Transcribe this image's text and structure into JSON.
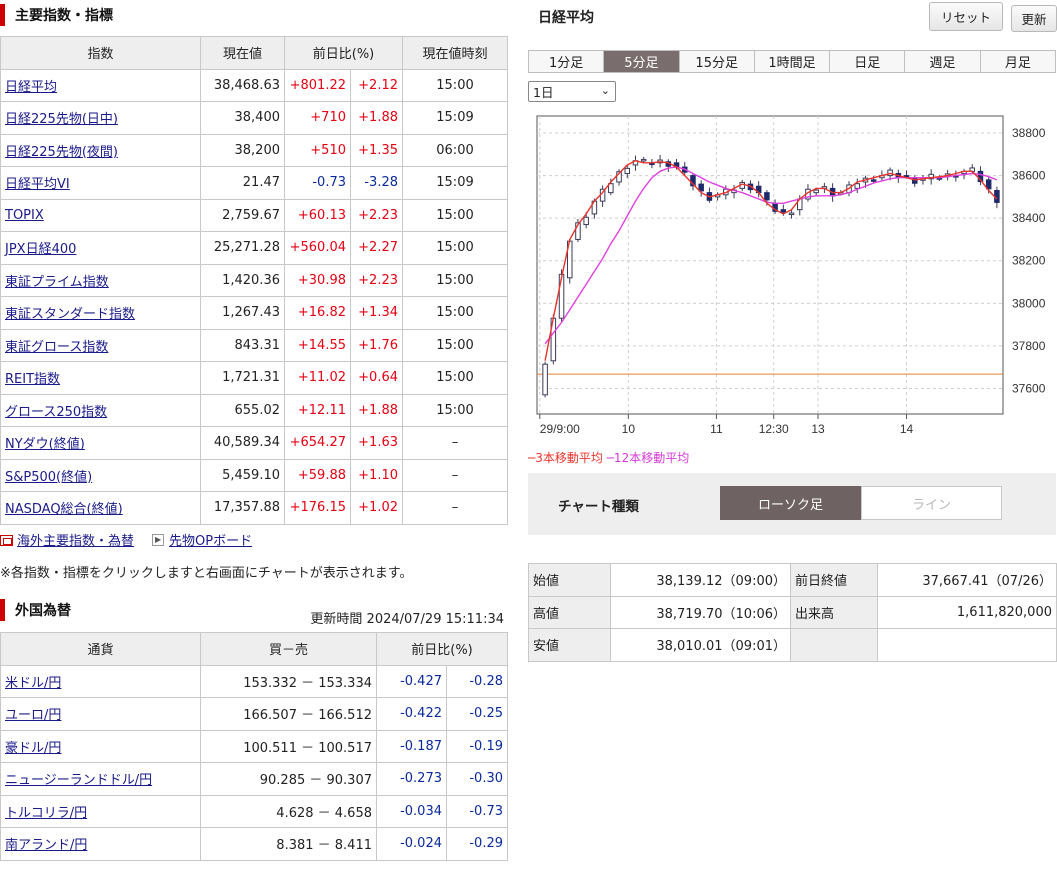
{
  "indices": {
    "section_title": "主要指数・指標",
    "headers": [
      "指数",
      "現在値",
      "前日比(%)",
      "現在値時刻"
    ],
    "rows": [
      {
        "name": "日経平均",
        "price": "38,468.63",
        "chg": "+801.22",
        "pct": "+2.12",
        "time": "15:00",
        "dir": "up"
      },
      {
        "name": "日経225先物(日中)",
        "price": "38,400",
        "chg": "+710",
        "pct": "+1.88",
        "time": "15:09",
        "dir": "up"
      },
      {
        "name": "日経225先物(夜間)",
        "price": "38,200",
        "chg": "+510",
        "pct": "+1.35",
        "time": "06:00",
        "dir": "up"
      },
      {
        "name": "日経平均VI",
        "price": "21.47",
        "chg": "-0.73",
        "pct": "-3.28",
        "time": "15:09",
        "dir": "dn"
      },
      {
        "name": "TOPIX",
        "price": "2,759.67",
        "chg": "+60.13",
        "pct": "+2.23",
        "time": "15:00",
        "dir": "up"
      },
      {
        "name": "JPX日経400",
        "price": "25,271.28",
        "chg": "+560.04",
        "pct": "+2.27",
        "time": "15:00",
        "dir": "up"
      },
      {
        "name": "東証プライム指数",
        "price": "1,420.36",
        "chg": "+30.98",
        "pct": "+2.23",
        "time": "15:00",
        "dir": "up"
      },
      {
        "name": "東証スタンダード指数",
        "price": "1,267.43",
        "chg": "+16.82",
        "pct": "+1.34",
        "time": "15:00",
        "dir": "up"
      },
      {
        "name": "東証グロース指数",
        "price": "843.31",
        "chg": "+14.55",
        "pct": "+1.76",
        "time": "15:00",
        "dir": "up"
      },
      {
        "name": "REIT指数",
        "price": "1,721.31",
        "chg": "+11.02",
        "pct": "+0.64",
        "time": "15:00",
        "dir": "up"
      },
      {
        "name": "グロース250指数",
        "price": "655.02",
        "chg": "+12.11",
        "pct": "+1.88",
        "time": "15:00",
        "dir": "up"
      },
      {
        "name": "NYダウ(終値)",
        "price": "40,589.34",
        "chg": "+654.27",
        "pct": "+1.63",
        "time": "–",
        "dir": "up"
      },
      {
        "name": "S&P500(終値)",
        "price": "5,459.10",
        "chg": "+59.88",
        "pct": "+1.10",
        "time": "–",
        "dir": "up"
      },
      {
        "name": "NASDAQ総合(終値)",
        "price": "17,357.88",
        "chg": "+176.15",
        "pct": "+1.02",
        "time": "–",
        "dir": "up"
      }
    ]
  },
  "links": {
    "overseas": "海外主要指数・為替",
    "futures_board": "先物OPボード",
    "note": "※各指数・指標をクリックしますと右画面にチャートが表示されます。"
  },
  "fx": {
    "section_title": "外国為替",
    "update_label": "更新時間",
    "update_time": "2024/07/29 15:11:34",
    "headers": [
      "通貨",
      "買－売",
      "前日比(%)"
    ],
    "rows": [
      {
        "name": "米ドル/円",
        "bidask": "153.332 － 153.334",
        "chg": "-0.427",
        "pct": "-0.28"
      },
      {
        "name": "ユーロ/円",
        "bidask": "166.507 － 166.512",
        "chg": "-0.422",
        "pct": "-0.25"
      },
      {
        "name": "豪ドル/円",
        "bidask": "100.511 － 100.517",
        "chg": "-0.187",
        "pct": "-0.19"
      },
      {
        "name": "ニュージーランドドル/円",
        "bidask": "90.285 － 90.307",
        "chg": "-0.273",
        "pct": "-0.30"
      },
      {
        "name": "トルコリラ/円",
        "bidask": "4.628 － 4.658",
        "chg": "-0.034",
        "pct": "-0.73"
      },
      {
        "name": "南アランド/円",
        "bidask": "8.381 － 8.411",
        "chg": "-0.024",
        "pct": "-0.29"
      }
    ]
  },
  "chart_panel": {
    "title": "日経平均",
    "reset_label": "リセット",
    "refresh_label": "更新",
    "tabs": [
      "1分足",
      "5分足",
      "15分足",
      "1時間足",
      "日足",
      "週足",
      "月足"
    ],
    "active_tab": "5分足",
    "period_selected": "1日",
    "legend_ma3": "─3本移動平均",
    "legend_ma12": "─12本移動平均",
    "chart_type_label": "チャート種類",
    "chart_type_options": [
      "ローソク足",
      "ライン"
    ],
    "chart_type_active": "ローソク足"
  },
  "stats": {
    "open_label": "始値",
    "open": "38,139.12（09:00）",
    "prev_close_label": "前日終値",
    "prev_close": "37,667.41（07/26）",
    "high_label": "高値",
    "high": "38,719.70（10:06）",
    "volume_label": "出来高",
    "volume": "1,611,820,000",
    "low_label": "安値",
    "low": "38,010.01（09:01）"
  },
  "colors": {
    "accent_red": "#cc0000",
    "up": "#e60012",
    "down": "#0a2a9b",
    "candle_down": "#1f2a6b",
    "ma3": "#e8332b",
    "ma12": "#e040e0",
    "prev_close_line": "#e87d2c"
  },
  "chart_data": {
    "type": "candlestick",
    "x_tick_labels": [
      "29/9:00",
      "10",
      "11",
      "12:30",
      "13",
      "14"
    ],
    "y_ticks": [
      37600,
      37800,
      38000,
      38200,
      38400,
      38600,
      38800
    ],
    "ylim": [
      37480,
      38880
    ],
    "prev_close": 37667.41,
    "series": [
      {
        "name": "3本移動平均",
        "values": [
          37730,
          37930,
          38120,
          38300,
          38370,
          38420,
          38480,
          38520,
          38570,
          38610,
          38650,
          38670,
          38660,
          38660,
          38665,
          38660,
          38640,
          38600,
          38560,
          38520,
          38500,
          38510,
          38520,
          38540,
          38560,
          38550,
          38520,
          38470,
          38440,
          38420,
          38440,
          38490,
          38520,
          38540,
          38540,
          38520,
          38520,
          38540,
          38570,
          38580,
          38590,
          38600,
          38610,
          38600,
          38590,
          38580,
          38585,
          38590,
          38595,
          38600,
          38610,
          38620,
          38620,
          38580,
          38530,
          38490
        ]
      },
      {
        "name": "12本移動平均",
        "values": [
          37810,
          37860,
          37910,
          37970,
          38030,
          38090,
          38150,
          38210,
          38280,
          38340,
          38410,
          38480,
          38540,
          38590,
          38620,
          38635,
          38640,
          38630,
          38610,
          38590,
          38570,
          38555,
          38540,
          38530,
          38520,
          38505,
          38490,
          38475,
          38470,
          38470,
          38480,
          38490,
          38500,
          38505,
          38505,
          38505,
          38510,
          38520,
          38535,
          38550,
          38565,
          38575,
          38585,
          38590,
          38590,
          38590,
          38590,
          38590,
          38590,
          38595,
          38600,
          38605,
          38610,
          38605,
          38595,
          38580
        ]
      }
    ]
  }
}
